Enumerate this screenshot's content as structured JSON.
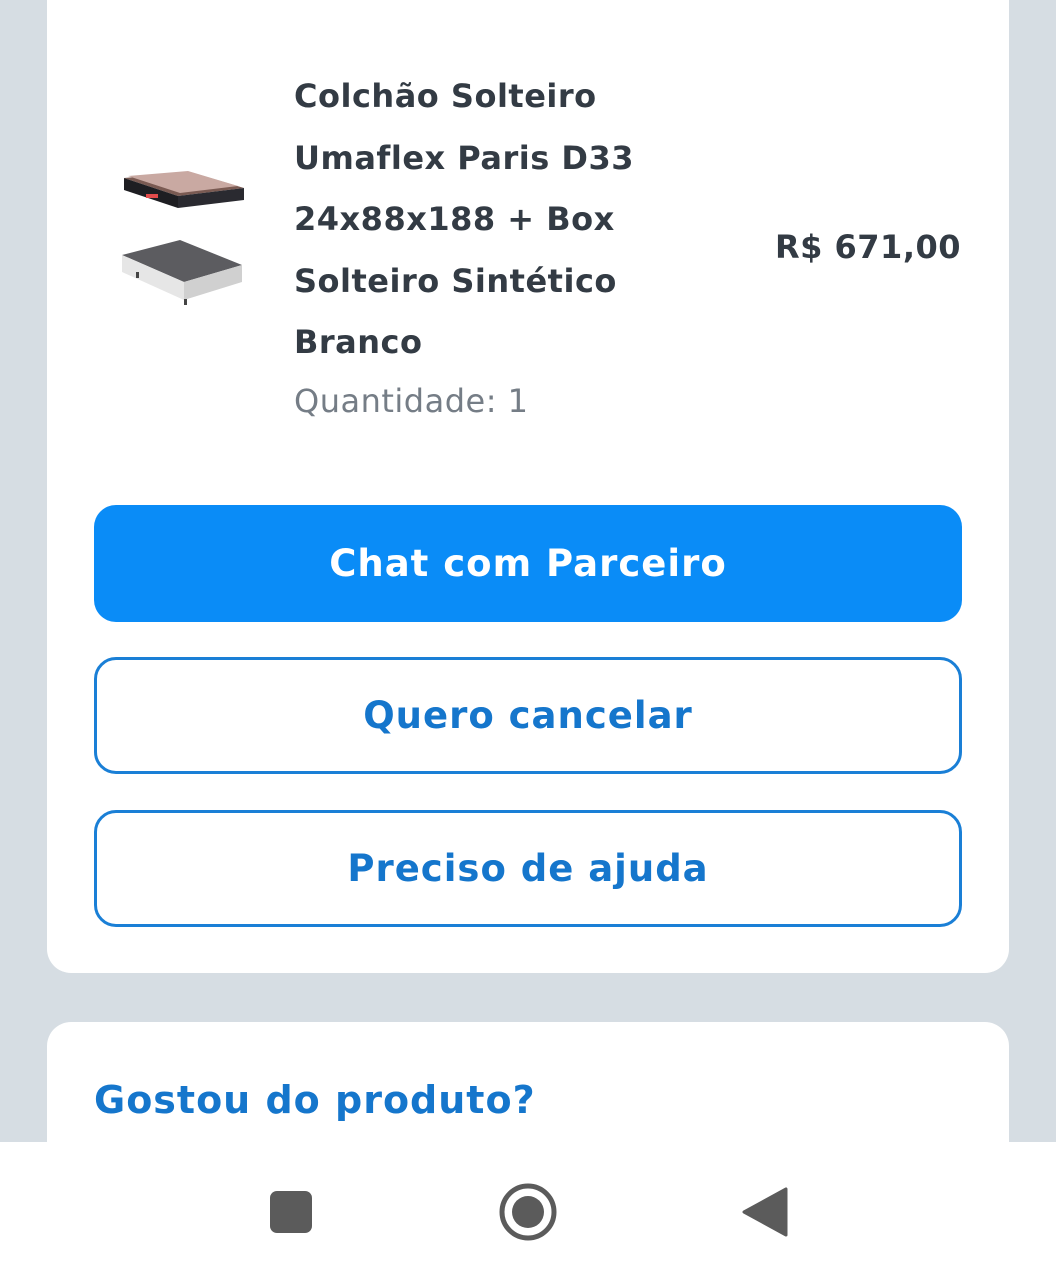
{
  "product": {
    "title": "Colchão Solteiro Umaflex Paris D33 24x88x188 + Box Solteiro Sintético Branco",
    "quantity_text": "Quantidade: 1",
    "price": "R$ 671,00",
    "image_icon": "mattress-box-image"
  },
  "actions": {
    "chat_label": "Chat com Parceiro",
    "cancel_label": "Quero cancelar",
    "help_label": "Preciso de ajuda"
  },
  "review": {
    "title": "Gostou do produto?"
  },
  "navbar": {
    "recents_icon": "square-icon",
    "home_icon": "circle-icon",
    "back_icon": "triangle-back-icon"
  },
  "colors": {
    "primary": "#0a8cf7",
    "accent_text": "#1576cc",
    "background": "#d6dde3",
    "card": "#ffffff"
  }
}
